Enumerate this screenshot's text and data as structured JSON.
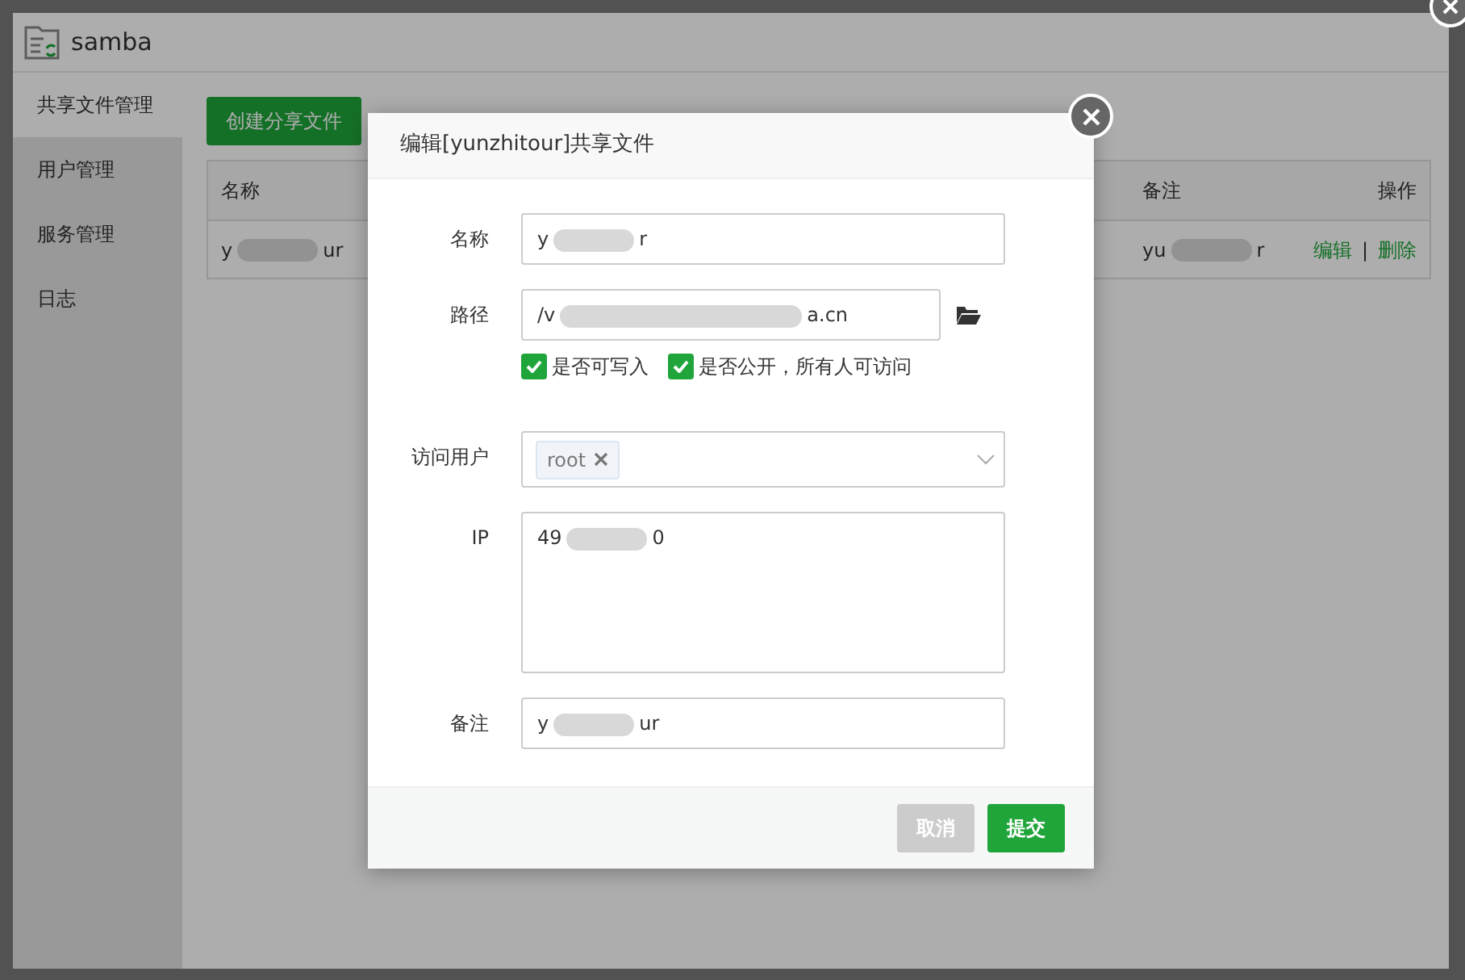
{
  "window": {
    "title": "samba"
  },
  "sidebar": {
    "items": [
      {
        "label": "共享文件管理",
        "selected": true
      },
      {
        "label": "用户管理",
        "selected": false
      },
      {
        "label": "服务管理",
        "selected": false
      },
      {
        "label": "日志",
        "selected": false
      }
    ]
  },
  "create_button": "创建分享文件",
  "table": {
    "columns": [
      "名称",
      "备注",
      "操作"
    ],
    "rows": [
      {
        "name": {
          "value_start": "y",
          "value_end": "ur"
        },
        "remark": {
          "value_start": "yu",
          "value_end": "r"
        },
        "actions": [
          "编辑",
          "删除"
        ],
        "separator": "|"
      }
    ]
  },
  "dialog": {
    "title": "编辑[yunzhitour]共享文件",
    "fields": [
      {
        "kind": "text",
        "label": "名称",
        "value_start": "y",
        "value_end": "r"
      },
      {
        "kind": "path",
        "label": "路径",
        "value_start": "/v",
        "value_end": "a.cn"
      },
      {
        "kind": "checks",
        "options": [
          {
            "label": "是否可写入",
            "checked": true
          },
          {
            "label": "是否公开，所有人可访问",
            "checked": true
          }
        ]
      },
      {
        "kind": "select",
        "label": "访问用户",
        "tags": [
          "root"
        ]
      },
      {
        "kind": "textarea",
        "label": "IP",
        "value_start": "49",
        "value_end": "0"
      },
      {
        "kind": "text",
        "label": "备注",
        "value_start": "y",
        "value_end": "ur"
      }
    ],
    "buttons": [
      {
        "label": "取消",
        "kind": "cancel"
      },
      {
        "label": "提交",
        "kind": "submit"
      }
    ]
  }
}
